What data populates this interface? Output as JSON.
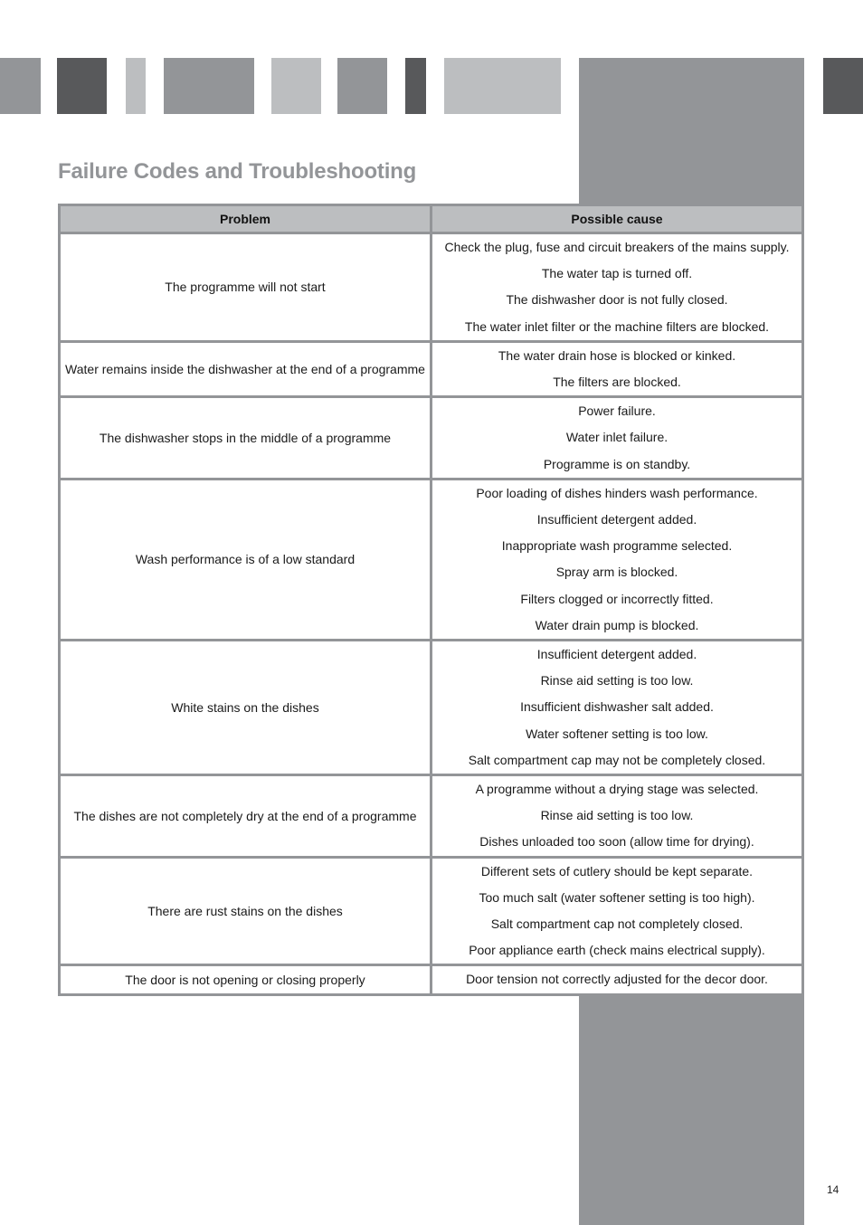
{
  "page": {
    "title": "Failure Codes and Troubleshooting",
    "page_number": "14"
  },
  "colors": {
    "dark_gray": "#58595b",
    "mid_gray": "#939598",
    "light_gray": "#bcbec0",
    "title": "#939598"
  },
  "table": {
    "headers": [
      "Problem",
      "Possible cause"
    ],
    "rows": [
      {
        "problem": "The programme will not start",
        "causes": [
          "Check the plug, fuse and circuit breakers of the mains supply.",
          "The water tap is turned off.",
          "The dishwasher door is not fully closed.",
          "The water inlet filter or the machine filters are blocked."
        ]
      },
      {
        "problem": "Water remains inside the dishwasher at the end of a programme",
        "causes": [
          "The water drain hose is blocked or kinked.",
          "The filters are blocked."
        ]
      },
      {
        "problem": "The dishwasher stops in the middle of a programme",
        "causes": [
          "Power failure.",
          "Water inlet failure.",
          "Programme is on standby."
        ]
      },
      {
        "problem": "Wash performance is of a low standard",
        "causes": [
          "Poor loading of dishes hinders wash performance.",
          "Insufficient detergent added.",
          "Inappropriate wash programme selected.",
          "Spray arm is blocked.",
          "Filters clogged or incorrectly fitted.",
          "Water drain pump is blocked."
        ]
      },
      {
        "problem": "White stains on the dishes",
        "causes": [
          "Insufficient detergent added.",
          "Rinse aid setting is too low.",
          "Insufficient dishwasher salt added.",
          "Water softener setting is too low.",
          "Salt compartment cap may not be completely closed."
        ]
      },
      {
        "problem": "The dishes are not completely dry at the end of a programme",
        "causes": [
          "A programme without a drying stage was selected.",
          "Rinse aid setting is too low.",
          "Dishes unloaded too soon (allow time for drying)."
        ]
      },
      {
        "problem": "There are rust stains on the dishes",
        "causes": [
          "Different sets of cutlery should be kept separate.",
          "Too much salt (water softener setting is too high).",
          "Salt compartment cap not completely closed.",
          "Poor appliance earth (check mains electrical supply)."
        ]
      },
      {
        "problem": "The door is not opening or closing properly",
        "causes": [
          "Door tension not correctly adjusted for the decor door."
        ]
      }
    ]
  }
}
